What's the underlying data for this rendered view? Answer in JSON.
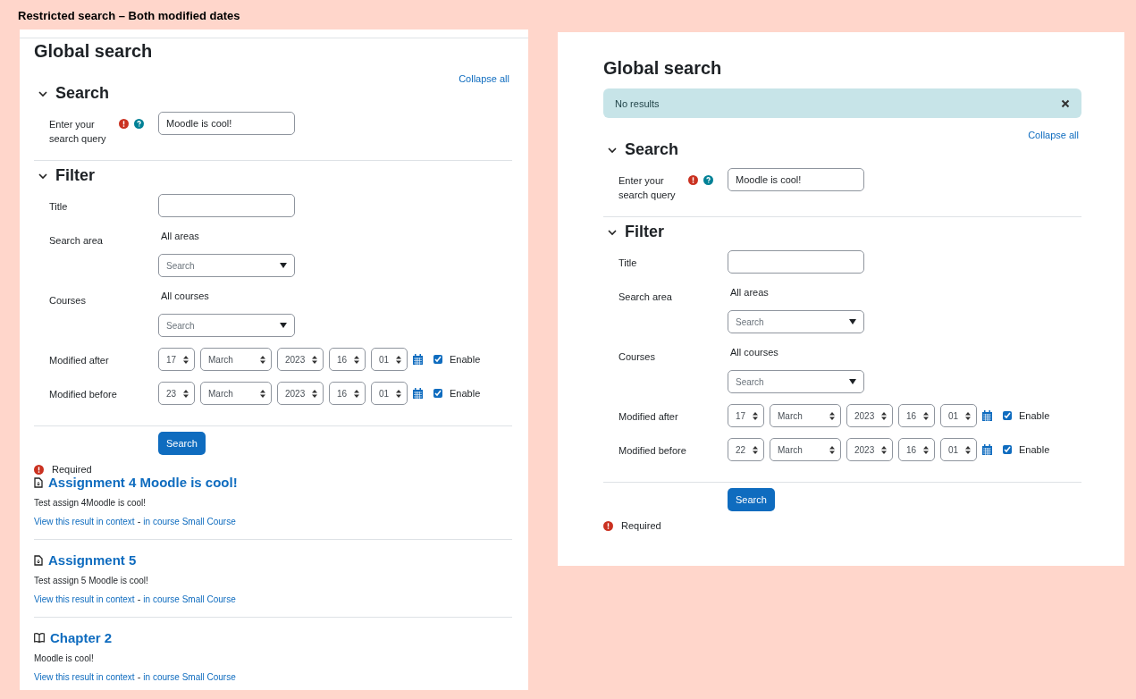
{
  "caption": "Restricted search – Both modified dates",
  "panels": [
    {
      "title": "Global search",
      "collapse_all": "Collapse all",
      "sections": [
        {
          "title": "Search",
          "expanded": true,
          "fields": [
            {
              "kind": "text",
              "label": "Enter your search query",
              "required": true,
              "help": true,
              "value": "Moodle is cool!"
            }
          ]
        },
        {
          "title": "Filter",
          "expanded": true,
          "fields": [
            {
              "kind": "text",
              "label": "Title",
              "required": false,
              "help": false
            },
            {
              "kind": "autocomplete",
              "label": "Search area",
              "selection": "All areas",
              "placeholder": "Search"
            },
            {
              "kind": "autocomplete",
              "label": "Courses",
              "selection": "All courses",
              "placeholder": "Search"
            },
            {
              "kind": "date",
              "label": "Modified after",
              "day": "17",
              "month": "March",
              "year": "2023",
              "hour": "16",
              "minute": "01",
              "enabled": true,
              "enable_label": "Enable"
            },
            {
              "kind": "date",
              "label": "Modified before",
              "day": "23",
              "month": "March",
              "year": "2023",
              "hour": "16",
              "minute": "01",
              "enabled": true,
              "enable_label": "Enable"
            }
          ]
        }
      ],
      "submit": "Search",
      "required_note": "Required",
      "results": [
        {
          "kind": "assignment",
          "title": "Assignment 4 Moodle is cool!",
          "snippet": "Test assign 4Moodle is cool!",
          "context_link": "View this result in context",
          "separator": "-",
          "course_link": "in course Small Course"
        },
        {
          "kind": "assignment",
          "title": "Assignment 5",
          "snippet": "Test assign 5 Moodle is cool!",
          "context_link": "View this result in context",
          "separator": "-",
          "course_link": "in course Small Course"
        },
        {
          "kind": "book",
          "title": "Chapter 2",
          "snippet": "Moodle is cool!",
          "context_link": "View this result in context",
          "separator": "-",
          "course_link": "in course Small Course"
        }
      ]
    },
    {
      "title": "Global search",
      "alert": {
        "text": "No results"
      },
      "collapse_all": "Collapse all",
      "sections": [
        {
          "title": "Search",
          "expanded": true,
          "fields": [
            {
              "kind": "text",
              "label": "Enter your search query",
              "required": true,
              "help": true,
              "value": "Moodle is cool!"
            }
          ]
        },
        {
          "title": "Filter",
          "expanded": true,
          "fields": [
            {
              "kind": "text",
              "label": "Title",
              "required": false,
              "help": false
            },
            {
              "kind": "autocomplete",
              "label": "Search area",
              "selection": "All areas",
              "placeholder": "Search"
            },
            {
              "kind": "autocomplete",
              "label": "Courses",
              "selection": "All courses",
              "placeholder": "Search"
            },
            {
              "kind": "date",
              "label": "Modified after",
              "day": "17",
              "month": "March",
              "year": "2023",
              "hour": "16",
              "minute": "01",
              "enabled": true,
              "enable_label": "Enable"
            },
            {
              "kind": "date",
              "label": "Modified before",
              "day": "22",
              "month": "March",
              "year": "2023",
              "hour": "16",
              "minute": "01",
              "enabled": true,
              "enable_label": "Enable"
            }
          ]
        }
      ],
      "submit": "Search",
      "required_note": "Required"
    }
  ]
}
